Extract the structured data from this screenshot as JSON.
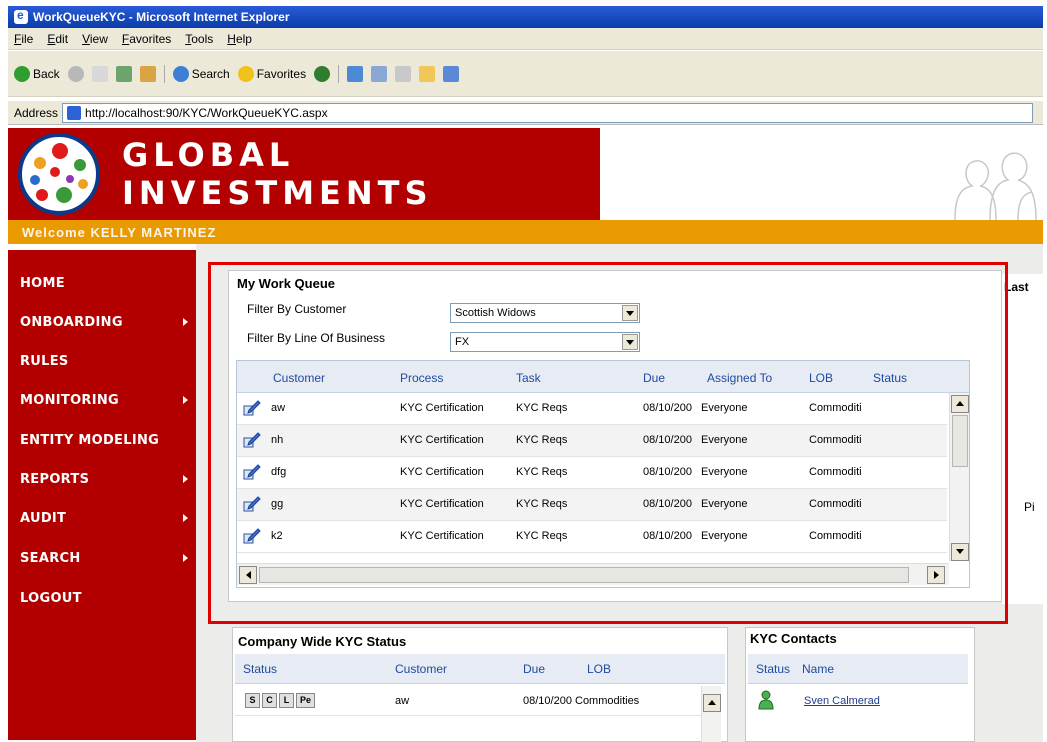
{
  "browser": {
    "title": "WorkQueueKYC - Microsoft Internet Explorer",
    "menu": [
      "File",
      "Edit",
      "View",
      "Favorites",
      "Tools",
      "Help"
    ],
    "toolbar": {
      "back": "Back",
      "search": "Search",
      "favorites": "Favorites"
    },
    "address_label": "Address",
    "address_url": "http://localhost:90/KYC/WorkQueueKYC.aspx"
  },
  "header": {
    "brand": "GLOBAL INVESTMENTS",
    "welcome": "Welcome KELLY MARTINEZ"
  },
  "sidebar": {
    "items": [
      {
        "label": "HOME",
        "has_submenu": false
      },
      {
        "label": "ONBOARDING",
        "has_submenu": true
      },
      {
        "label": "RULES",
        "has_submenu": false
      },
      {
        "label": "MONITORING",
        "has_submenu": true
      },
      {
        "label": "ENTITY MODELING",
        "has_submenu": false
      },
      {
        "label": "REPORTS",
        "has_submenu": true
      },
      {
        "label": "AUDIT",
        "has_submenu": true
      },
      {
        "label": "SEARCH",
        "has_submenu": true
      },
      {
        "label": "LOGOUT",
        "has_submenu": false
      }
    ]
  },
  "work_queue": {
    "title": "My Work Queue",
    "filter_customer_label": "Filter By Customer",
    "filter_customer_value": "Scottish Widows",
    "filter_lob_label": "Filter By Line Of Business",
    "filter_lob_value": "FX",
    "columns": [
      "Customer",
      "Process",
      "Task",
      "Due",
      "Assigned To",
      "LOB",
      "Status"
    ],
    "rows": [
      {
        "customer": "aw",
        "process": "KYC Certification",
        "task": "KYC Reqs",
        "due": "08/10/200",
        "assigned": "Everyone",
        "lob": "Commoditi"
      },
      {
        "customer": "nh",
        "process": "KYC Certification",
        "task": "KYC Reqs",
        "due": "08/10/200",
        "assigned": "Everyone",
        "lob": "Commoditi"
      },
      {
        "customer": "dfg",
        "process": "KYC Certification",
        "task": "KYC Reqs",
        "due": "08/10/200",
        "assigned": "Everyone",
        "lob": "Commoditi"
      },
      {
        "customer": "gg",
        "process": "KYC Certification",
        "task": "KYC Reqs",
        "due": "08/10/200",
        "assigned": "Everyone",
        "lob": "Commoditi"
      },
      {
        "customer": "k2",
        "process": "KYC Certification",
        "task": "KYC Reqs",
        "due": "08/10/200",
        "assigned": "Everyone",
        "lob": "Commoditi"
      }
    ]
  },
  "side_notes": {
    "last": "Last",
    "p": "Pi"
  },
  "company_status": {
    "title": "Company Wide KYC Status",
    "columns": [
      "Status",
      "Customer",
      "Due",
      "LOB"
    ],
    "row": {
      "badges": [
        "S",
        "C",
        "L",
        "Pe"
      ],
      "customer": "aw",
      "due": "08/10/200",
      "lob": "Commodities"
    }
  },
  "kyc_contacts": {
    "title": "KYC Contacts",
    "columns": [
      "Status",
      "Name"
    ],
    "contact": "Sven Calmerad"
  },
  "colors": {
    "brand_red": "#b20000",
    "welcome_orange": "#e89a00",
    "highlight_red": "#e00000",
    "link_blue": "#1f4aa0"
  }
}
